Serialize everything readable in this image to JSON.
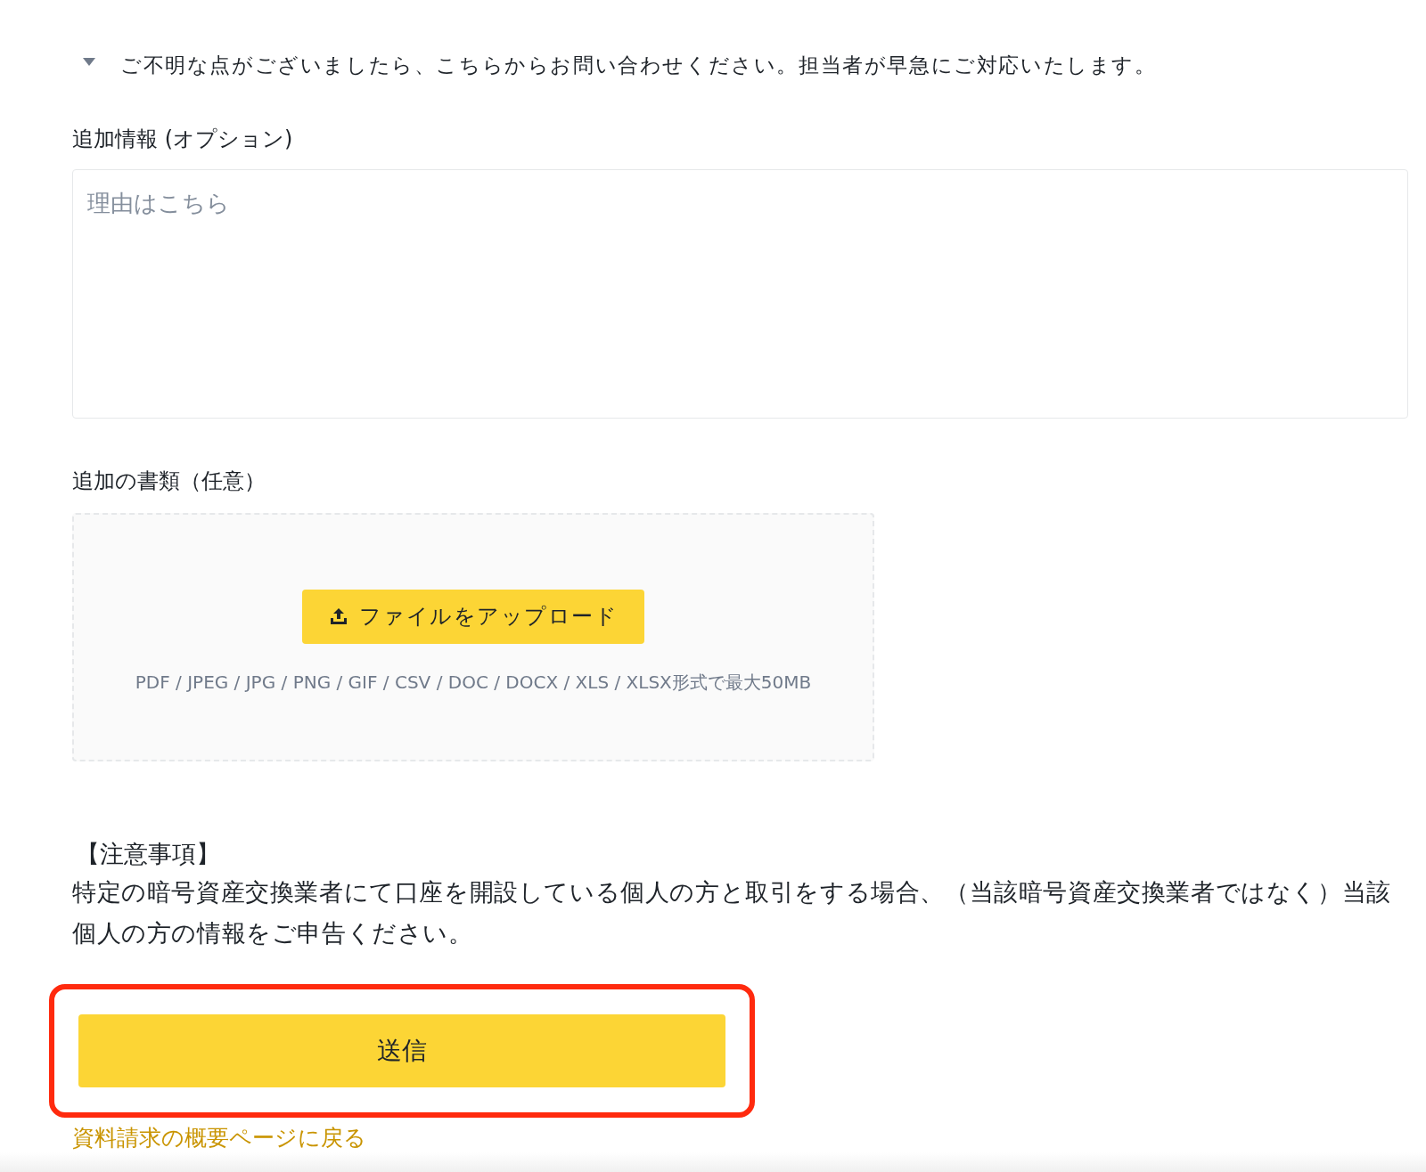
{
  "notice": {
    "text": "ご不明な点がございましたら、こちらからお問い合わせください。担当者が早急にご対応いたします。"
  },
  "additional_info": {
    "label": "追加情報 (オプション)",
    "placeholder": "理由はこちら"
  },
  "documents": {
    "label": "追加の書類（任意）",
    "upload_button": "ファイルをアップロード",
    "formats": "PDF / JPEG / JPG / PNG / GIF / CSV / DOC / DOCX / XLS / XLSX形式で最大50MB"
  },
  "caution": {
    "title": "【注意事項】",
    "text": "特定の暗号資産交換業者にて口座を開設している個人の方と取引をする場合、（当該暗号資産交換業者ではなく）当該個人の方の情報をご申告ください。"
  },
  "submit": {
    "label": "送信",
    "highlighted": true
  },
  "back_link": "資料請求の概要ページに戻る"
}
